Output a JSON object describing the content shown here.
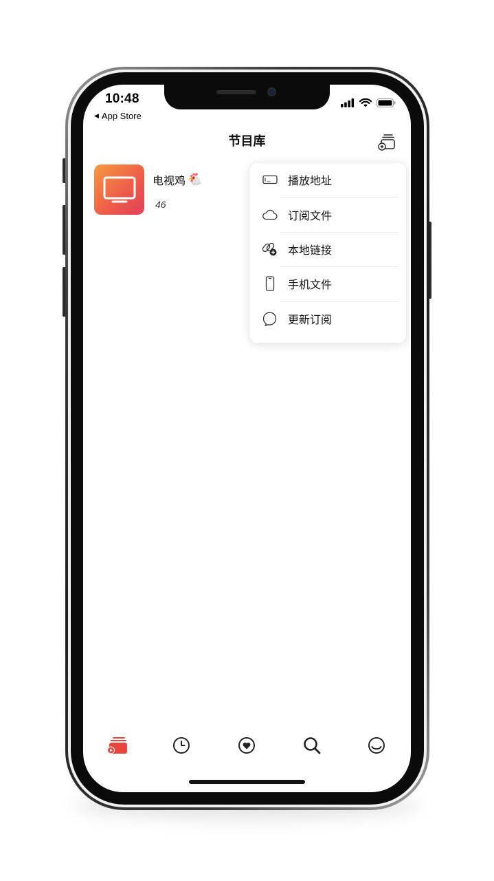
{
  "status_bar": {
    "time": "10:48",
    "back_label": "App Store",
    "back_glyph": "◀"
  },
  "nav": {
    "title": "节目库",
    "add_icon": "stack-plus-icon"
  },
  "channel": {
    "name": "电视鸡",
    "emoji": "🐔",
    "count": "46",
    "thumb_icon": "tv-icon"
  },
  "menu": {
    "items": [
      {
        "label": "播放地址",
        "icon": "address-field-icon"
      },
      {
        "label": "订阅文件",
        "icon": "cloud-icon"
      },
      {
        "label": "本地链接",
        "icon": "link-add-icon"
      },
      {
        "label": "手机文件",
        "icon": "phone-icon"
      },
      {
        "label": "更新订阅",
        "icon": "chat-bubble-icon"
      }
    ]
  },
  "tabs": [
    {
      "icon": "library-icon",
      "active": true
    },
    {
      "icon": "clock-icon",
      "active": false
    },
    {
      "icon": "heart-icon",
      "active": false
    },
    {
      "icon": "search-icon",
      "active": false
    },
    {
      "icon": "profile-icon",
      "active": false
    }
  ],
  "colors": {
    "accent": "#e8453c",
    "thumb_gradient_start": "#f59a40",
    "thumb_gradient_end": "#e0405a"
  }
}
